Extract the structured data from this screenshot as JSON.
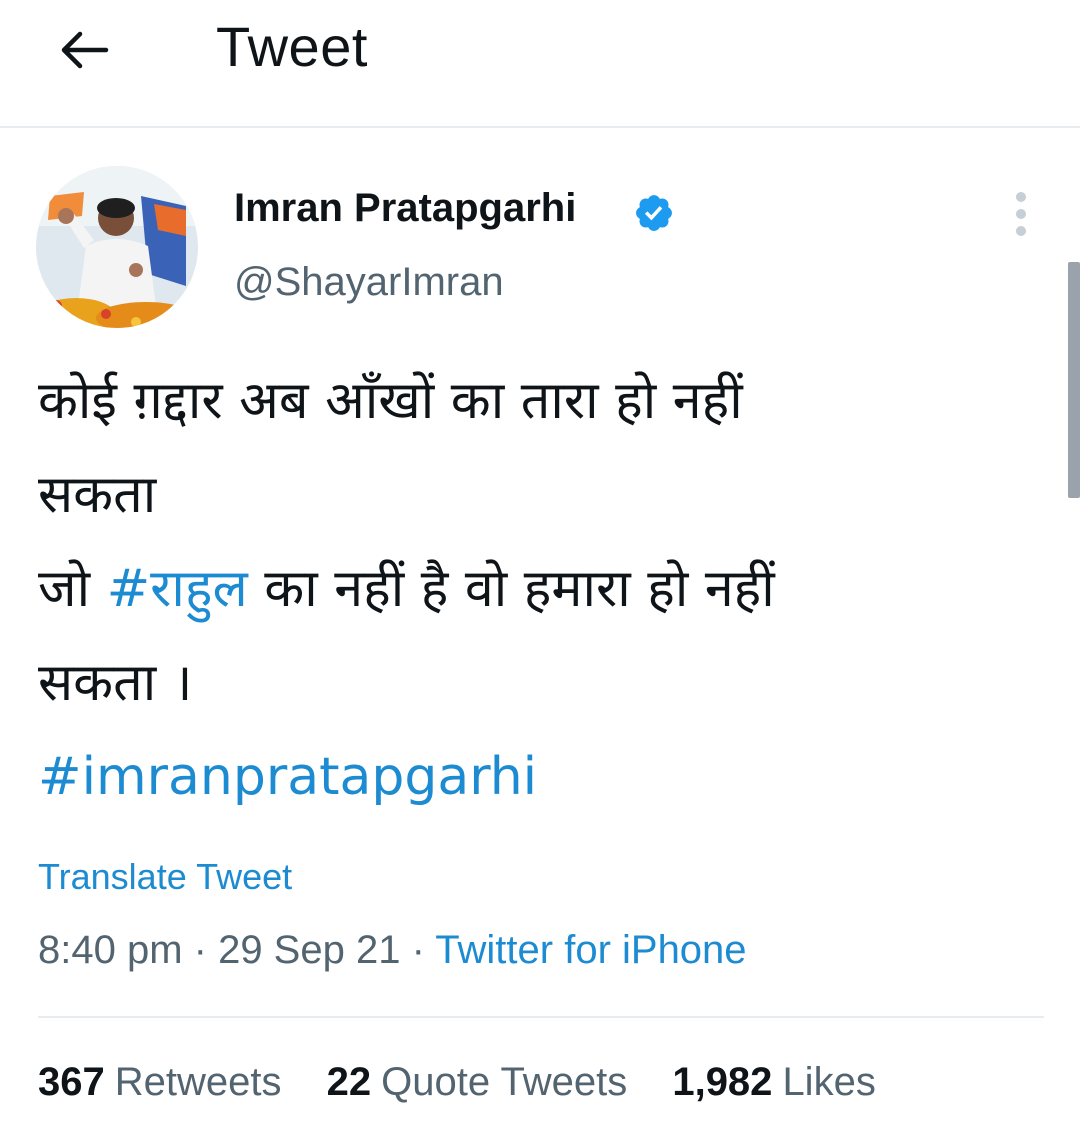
{
  "header": {
    "back_icon": "arrow-left-icon",
    "title": "Tweet"
  },
  "author": {
    "avatar_icon": "profile-photo",
    "display_name": "Imran Pratapgarhi",
    "verified_icon": "verified-badge-icon",
    "handle": "@ShayarImran"
  },
  "more_icon": "more-vertical-icon",
  "tweet": {
    "line1": "कोई ग़द्दार अब आँखों का तारा हो नहीं",
    "line2": "सकता",
    "line3_prefix": "जो ",
    "line3_hashtag": "#राहुल",
    "line3_suffix": " का नहीं है वो हमारा हो नहीं",
    "line4": "सकता ।",
    "hashtag2": "#imranpratapgarhi"
  },
  "translate_label": "Translate Tweet",
  "meta": {
    "time": "8:40 pm",
    "separator1": " · ",
    "date": "29 Sep 21",
    "separator2": " · ",
    "source": "Twitter for iPhone"
  },
  "stats": [
    {
      "count": "367",
      "label": "Retweets"
    },
    {
      "count": "22",
      "label": "Quote Tweets"
    },
    {
      "count": "1,982",
      "label": "Likes"
    }
  ],
  "colors": {
    "link": "#1d8bd1",
    "text": "#0f1419",
    "secondary": "#536471",
    "verified": "#1d9bf0"
  }
}
